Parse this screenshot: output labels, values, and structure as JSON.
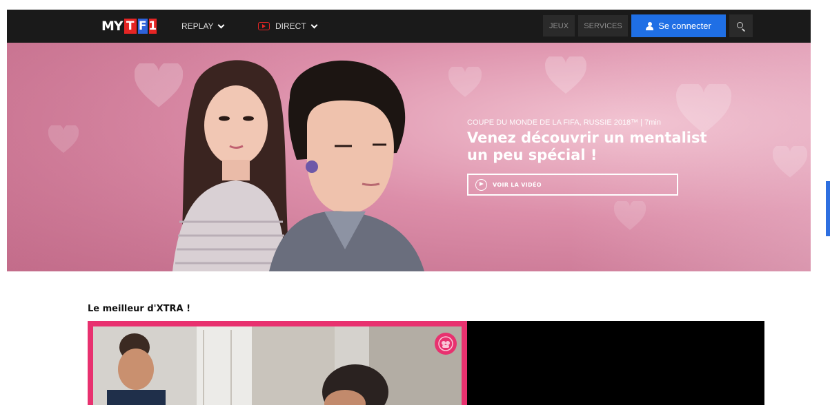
{
  "nav": {
    "logo": {
      "my": "MY",
      "t": "T",
      "f": "F",
      "one": "1"
    },
    "replay_label": "REPLAY",
    "direct_label": "DIRECT",
    "jeux_label": "JEUX",
    "services_label": "SERVICES",
    "connect_label": "Se connecter"
  },
  "hero": {
    "meta": "COUPE DU MONDE DE LA FIFA, RUSSIE 2018™ | 7min",
    "title": "Venez découvrir un mentalist un peu spécial !",
    "button_label": "VOIR LA VIDÉO"
  },
  "section": {
    "title": "Le meilleur d'XTRA !"
  },
  "colors": {
    "nav_bg": "#1a1a1a",
    "accent_blue": "#1f6fe5",
    "accent_pink": "#e8316f",
    "logo_red": "#e52524"
  },
  "icons": [
    "chevron-down-icon",
    "live-tv-icon",
    "user-icon",
    "search-icon",
    "play-circle-icon",
    "badge-icon"
  ]
}
